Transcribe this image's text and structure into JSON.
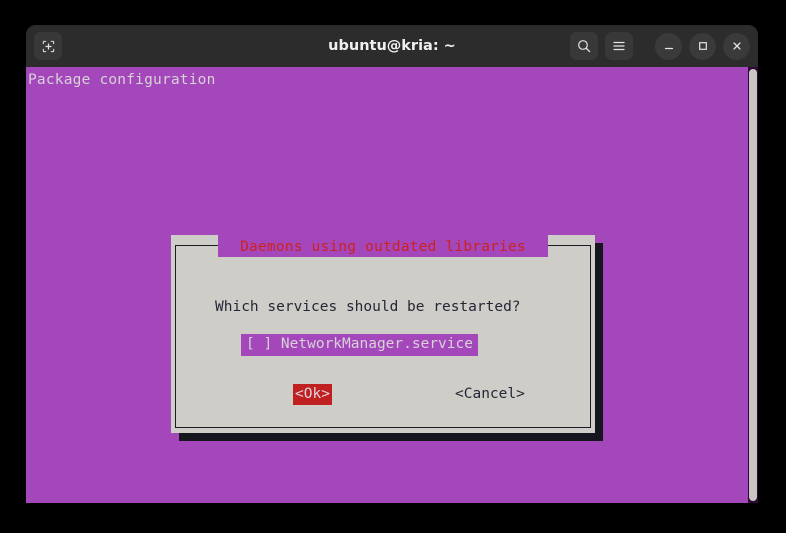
{
  "window": {
    "title": "ubuntu@kria: ~",
    "new_tab_icon": "new-tab-icon",
    "search_icon": "search-icon",
    "menu_icon": "hamburger-menu-icon",
    "minimize_icon": "minimize-icon",
    "maximize_icon": "maximize-icon",
    "close_icon": "close-icon"
  },
  "terminal": {
    "header_text": "Package configuration",
    "background_color": "#A347BB",
    "foreground_color": "#d8d2d8",
    "scrollbar": "vertical-scrollbar"
  },
  "dialog": {
    "title": "Daemons using outdated libraries",
    "title_color": "#cc2222",
    "background_color": "#cfcdc8",
    "question": "Which services should be restarted?",
    "items": [
      {
        "checkbox": "[ ]",
        "label": "NetworkManager.service",
        "full_text": "[ ] NetworkManager.service",
        "selected": true,
        "checked": false
      }
    ],
    "buttons": [
      {
        "label": "<Ok>",
        "focused": true,
        "color": "#c02020"
      },
      {
        "label": "<Cancel>",
        "focused": false,
        "color": "#262636"
      }
    ]
  }
}
